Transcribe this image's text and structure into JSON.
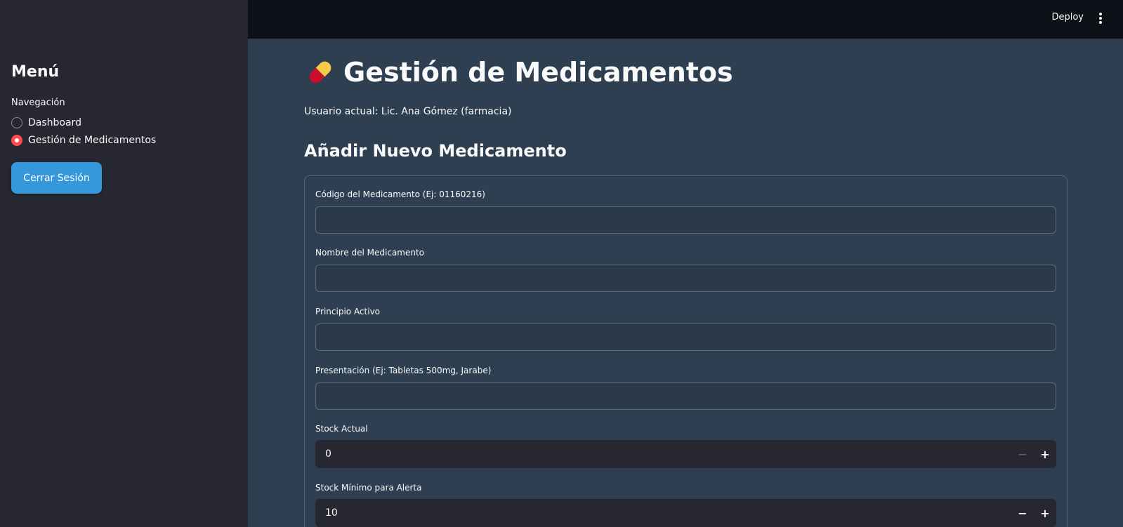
{
  "sidebar": {
    "title": "Menú",
    "nav_label": "Navegación",
    "options": [
      {
        "label": "Dashboard",
        "selected": false
      },
      {
        "label": "Gestión de Medicamentos",
        "selected": true
      }
    ],
    "logout_label": "Cerrar Sesión"
  },
  "topbar": {
    "deploy_label": "Deploy",
    "menu_icon": "kebab-menu-icon"
  },
  "main": {
    "title": "Gestión de Medicamentos",
    "title_icon": "pill-icon",
    "user_line": "Usuario actual: Lic. Ana Gómez (farmacia)",
    "section_title": "Añadir Nuevo Medicamento",
    "form": {
      "codigo_label": "Código del Medicamento (Ej: 01160216)",
      "codigo_value": "",
      "nombre_label": "Nombre del Medicamento",
      "nombre_value": "",
      "principio_label": "Principio Activo",
      "principio_value": "",
      "presentacion_label": "Presentación (Ej: Tabletas 500mg, Jarabe)",
      "presentacion_value": "",
      "stock_label": "Stock Actual",
      "stock_value": "0",
      "stock_min_label": "Stock Mínimo para Alerta",
      "stock_min_value": "10",
      "minus_symbol": "−",
      "plus_symbol": "+"
    }
  },
  "colors": {
    "sidebar_bg": "#262730",
    "main_bg": "#2e3f52",
    "topbar_bg": "#0e1117",
    "accent_red": "#ff4b4b",
    "button_blue": "#3498db"
  }
}
